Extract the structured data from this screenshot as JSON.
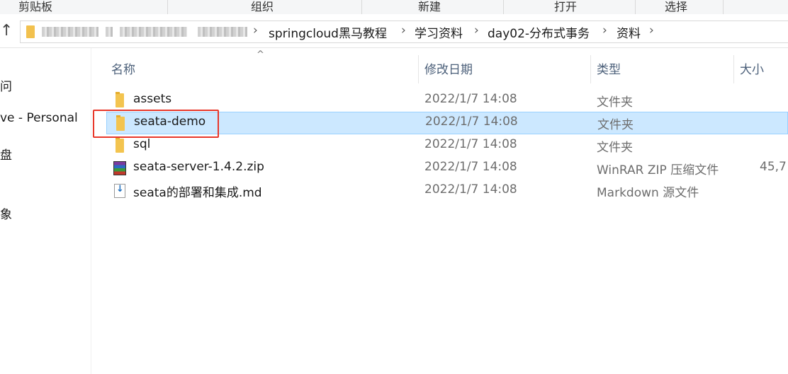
{
  "ribbon": {
    "groups": [
      "剪贴板",
      "组织",
      "新建",
      "打开",
      "选择"
    ]
  },
  "address": {
    "up_icon": "↑",
    "breadcrumbs": [
      "springcloud黑马教程",
      "学习资料",
      "day02-分布式事务",
      "资料"
    ],
    "chevron": "›"
  },
  "nav": {
    "items": [
      "问",
      "ve - Personal",
      "盘",
      "象"
    ]
  },
  "columns": {
    "name": "名称",
    "date": "修改日期",
    "type": "类型",
    "size": "大小"
  },
  "files": [
    {
      "name": "assets",
      "date": "2022/1/7 14:08",
      "type": "文件夹",
      "size": "",
      "icon": "folder-icon"
    },
    {
      "name": "seata-demo",
      "date": "2022/1/7 14:08",
      "type": "文件夹",
      "size": "",
      "icon": "folder-icon"
    },
    {
      "name": "sql",
      "date": "2022/1/7 14:08",
      "type": "文件夹",
      "size": "",
      "icon": "folder-icon"
    },
    {
      "name": "seata-server-1.4.2.zip",
      "date": "2022/1/7 14:08",
      "type": "WinRAR ZIP 压缩文件",
      "size": "45,7",
      "icon": "winrar-zip-icon"
    },
    {
      "name": "seata的部署和集成.md",
      "date": "2022/1/7 14:08",
      "type": "Markdown 源文件",
      "size": "",
      "icon": "markdown-file-icon"
    }
  ],
  "colors": {
    "selection_bg": "#cce8ff",
    "selection_border": "#99d1ff",
    "highlight_box": "#e8372a",
    "folder": "#f3c44f"
  }
}
